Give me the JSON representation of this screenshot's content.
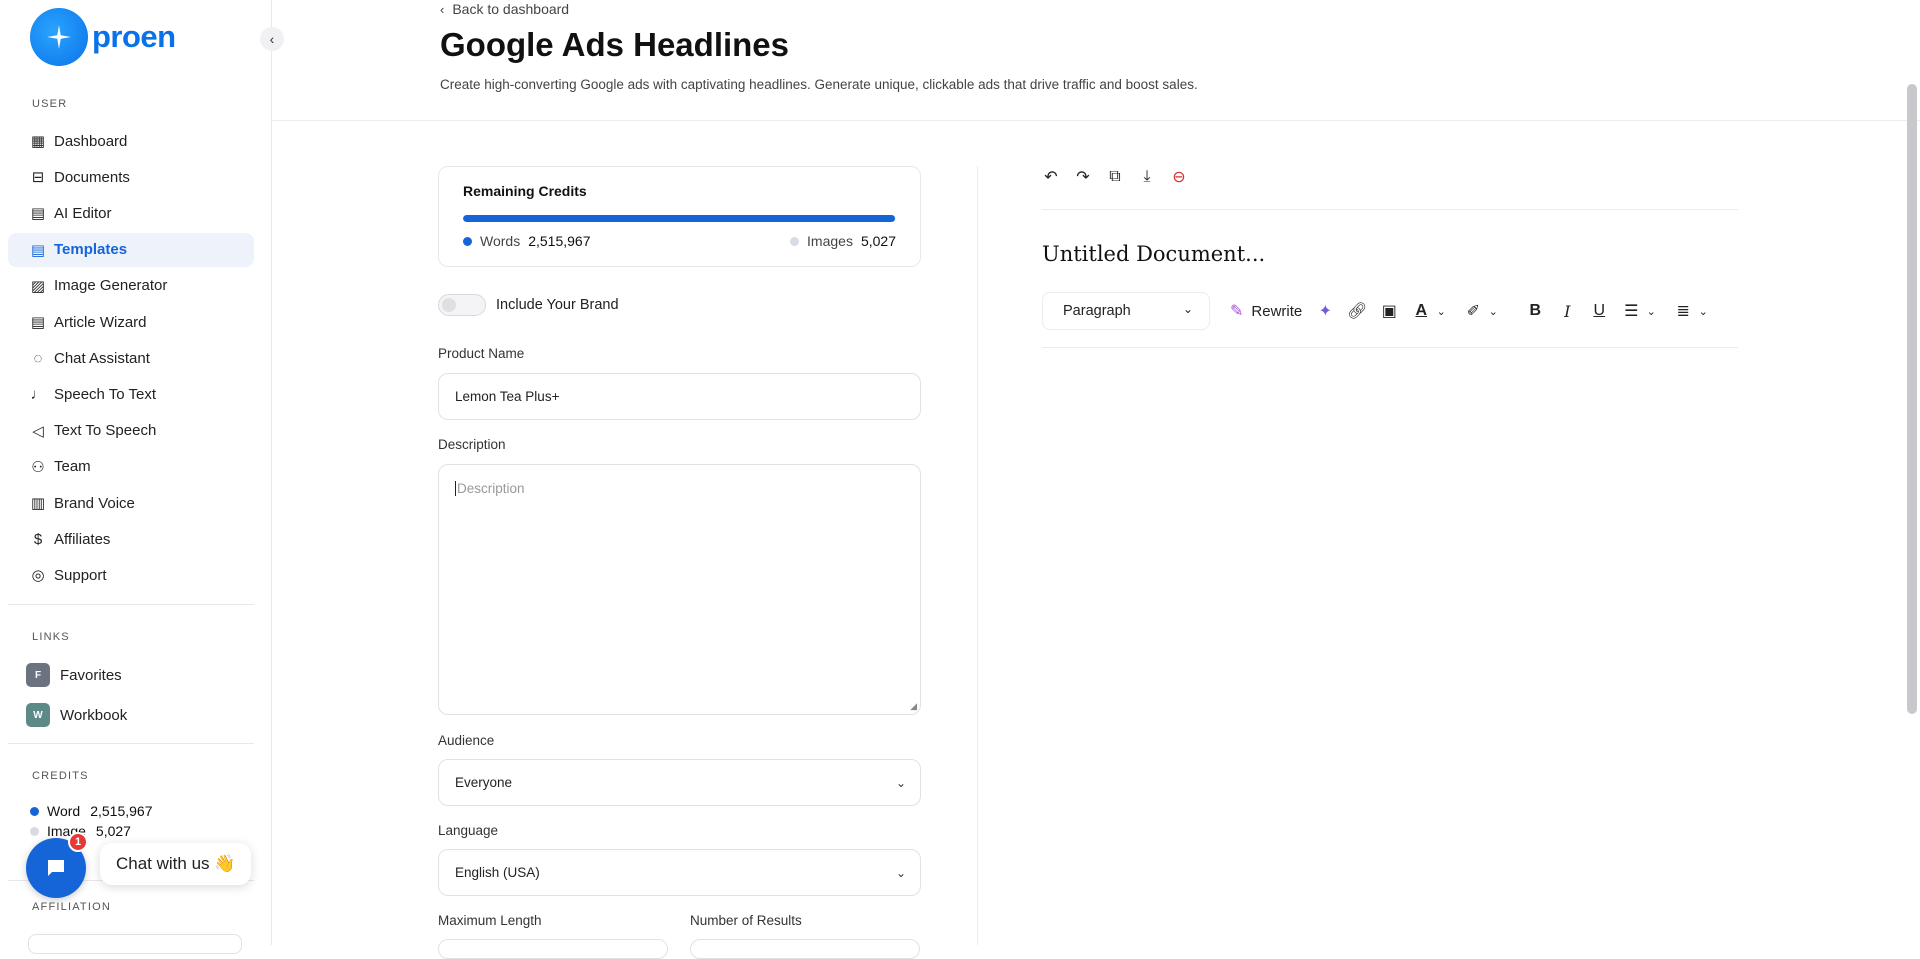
{
  "brand": {
    "name": "proen",
    "accent": "#1565d8"
  },
  "sidebar": {
    "user_label": "USER",
    "items": [
      {
        "label": "Dashboard",
        "icon": "grid-icon"
      },
      {
        "label": "Documents",
        "icon": "archive-icon"
      },
      {
        "label": "AI Editor",
        "icon": "notebook-icon"
      },
      {
        "label": "Templates",
        "icon": "file-text-icon",
        "active": true
      },
      {
        "label": "Image Generator",
        "icon": "image-icon"
      },
      {
        "label": "Article Wizard",
        "icon": "article-icon"
      },
      {
        "label": "Chat Assistant",
        "icon": "message-icon"
      },
      {
        "label": "Speech To Text",
        "icon": "microphone-icon"
      },
      {
        "label": "Text To Speech",
        "icon": "speaker-icon"
      },
      {
        "label": "Team",
        "icon": "user-plus-icon"
      },
      {
        "label": "Brand Voice",
        "icon": "brand-icon"
      },
      {
        "label": "Affiliates",
        "icon": "dollar-icon"
      },
      {
        "label": "Support",
        "icon": "lifebuoy-icon"
      }
    ],
    "links_label": "LINKS",
    "links": [
      {
        "badge": "F",
        "label": "Favorites",
        "color": "#6b7280"
      },
      {
        "badge": "W",
        "label": "Workbook",
        "color": "#5b8a87"
      }
    ],
    "credits_label": "CREDITS",
    "credits": {
      "word_label": "Word",
      "word_value": "2,515,967",
      "image_label": "Image",
      "image_value": "5,027"
    },
    "affiliation_label": "AFFILIATION"
  },
  "chat": {
    "badge_count": "1",
    "bubble_text": "Chat with us 👋"
  },
  "header": {
    "back_label": "Back to dashboard",
    "title": "Google Ads Headlines",
    "description": "Create high-converting Google ads with captivating headlines. Generate unique, clickable ads that drive traffic and boost sales."
  },
  "credits_card": {
    "title": "Remaining Credits",
    "words_label": "Words",
    "words_value": "2,515,967",
    "images_label": "Images",
    "images_value": "5,027",
    "fill_fraction": 0.998
  },
  "form": {
    "brand_toggle_label": "Include Your Brand",
    "brand_toggle_on": false,
    "product_name_label": "Product Name",
    "product_name_value": "Lemon Tea Plus+",
    "description_label": "Description",
    "description_placeholder": "Description",
    "audience_label": "Audience",
    "audience_value": "Everyone",
    "language_label": "Language",
    "language_value": "English (USA)",
    "max_length_label": "Maximum Length",
    "results_label": "Number of Results"
  },
  "editor": {
    "doc_title": "Untitled Document...",
    "paragraph_label": "Paragraph",
    "rewrite_label": "Rewrite"
  }
}
